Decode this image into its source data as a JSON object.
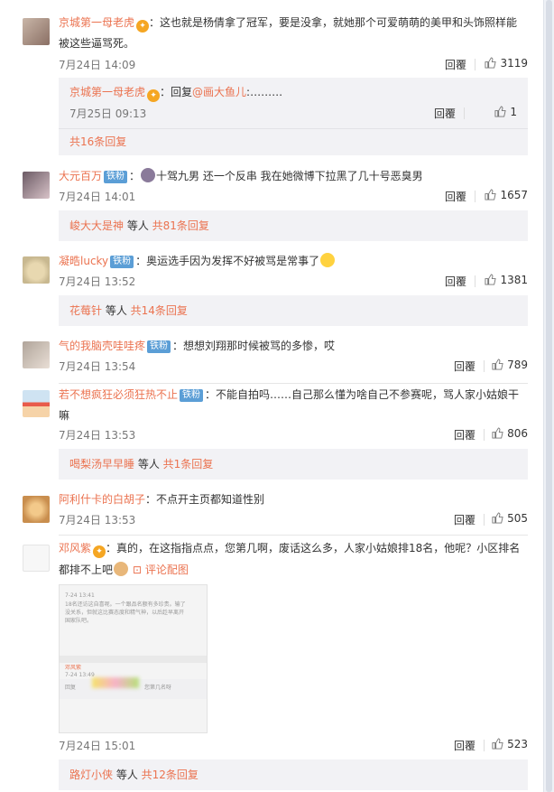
{
  "comments": [
    {
      "username": "京城第一母老虎",
      "text": "：这也就是杨倩拿了冠军，要是没拿，就她那个可爱萌萌的美甲和头饰照样能",
      "text2": "被这些逼骂死。",
      "time": "7月24日 14:09",
      "reply_label": "回覆",
      "likes": "3119",
      "sub_reply": {
        "username": "京城第一母老虎",
        "text_prefix": "：回复",
        "mention": "@画大鱼儿",
        "text_suffix": ":………",
        "time": "7月25日 09:13",
        "reply_label": "回覆",
        "likes": "1"
      },
      "more": "共16条回复"
    },
    {
      "username": "大元百万",
      "badge": "铁粉",
      "text": "十驾九男  还一个反串  我在她微博下拉黑了几十号恶臭男",
      "time": "7月24日 14:01",
      "reply_label": "回覆",
      "likes": "1657",
      "more_user": "峻大大是神",
      "more_mid": " 等人 ",
      "more": "共81条回复"
    },
    {
      "username": "凝晧lucky",
      "badge": "铁粉",
      "text": "：奥运选手因为发挥不好被骂是常事了",
      "time": "7月24日 13:52",
      "reply_label": "回覆",
      "likes": "1381",
      "more_user": "花莓针",
      "more_mid": " 等人 ",
      "more": "共14条回复"
    },
    {
      "username": "气的我脑壳哇哇疼",
      "badge": "铁粉",
      "text": "：想想刘翔那时候被骂的多惨，哎",
      "time": "7月24日 13:54",
      "reply_label": "回覆",
      "likes": "789"
    },
    {
      "username": "若不想疯狂必须狂热不止",
      "badge": "铁粉",
      "text": "：不能自拍吗……自己那么懂为啥自己不参赛呢，骂人家小姑娘干",
      "text2": "嘛",
      "time": "7月24日 13:53",
      "reply_label": "回覆",
      "likes": "806",
      "more_user": "喝梨汤早早睡",
      "more_mid": " 等人 ",
      "more": "共1条回复"
    },
    {
      "username": "阿利什卡的白胡子",
      "text": "：不点开主页都知道性别",
      "time": "7月24日 13:53",
      "reply_label": "回覆",
      "likes": "505"
    },
    {
      "username": "邓风紫",
      "text": "：真的，在这指指点点，您第几啊，废话这么多，人家小姑娘排18名，他呢？小区排名",
      "text2": "都排不上吧",
      "pic_label": "评论配图",
      "image_lines": [
        "7-24 13:41",
        "18名还访这自喜呢。一个跟品名额有多珍贵。输了",
        "没关系，但就这比赛态度和精气神，以后趁早离开",
        "国家队吧。",
        "邓风紫",
        "7-24 13:49",
        "回复",
        "您第几名呀"
      ],
      "time": "7月24日 15:01",
      "reply_label": "回覆",
      "likes": "523",
      "more_user": "路灯小侠",
      "more_mid": " 等人 ",
      "more": "共12条回复"
    }
  ]
}
